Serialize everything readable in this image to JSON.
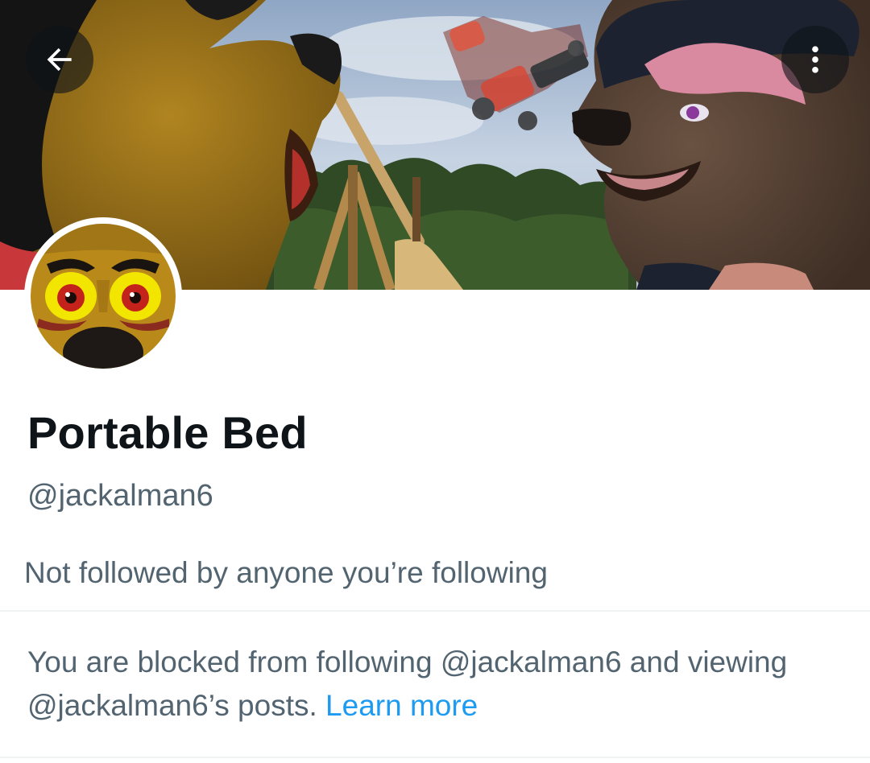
{
  "header": {
    "back_icon": "arrow-left-icon",
    "more_icon": "more-vertical-icon"
  },
  "profile": {
    "display_name": "Portable Bed",
    "handle": "@jackalman6",
    "followers_note": "Not followed by anyone you’re following"
  },
  "block_notice": {
    "text": "You are blocked from following @jackalman6 and viewing @jackalman6’s posts.",
    "link_label": "Learn more"
  },
  "colors": {
    "primary_text": "#0f1419",
    "secondary_text": "#536471",
    "link": "#1d9bf0",
    "divider": "#eff3f4"
  }
}
